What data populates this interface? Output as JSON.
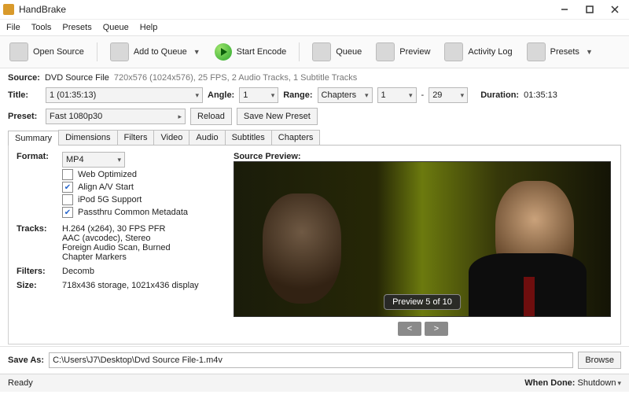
{
  "window": {
    "title": "HandBrake"
  },
  "menu": {
    "file": "File",
    "tools": "Tools",
    "presets": "Presets",
    "queue": "Queue",
    "help": "Help"
  },
  "toolbar": {
    "open_source": "Open Source",
    "add_to_queue": "Add to Queue",
    "start_encode": "Start Encode",
    "queue": "Queue",
    "preview": "Preview",
    "activity_log": "Activity Log",
    "presets": "Presets"
  },
  "source": {
    "label": "Source:",
    "name": "DVD Source File",
    "details": "720x576 (1024x576), 25 FPS, 2 Audio Tracks, 1 Subtitle Tracks"
  },
  "title": {
    "label": "Title:",
    "value": "1 (01:35:13)",
    "angle_label": "Angle:",
    "angle": "1",
    "range_label": "Range:",
    "range_mode": "Chapters",
    "range_from": "1",
    "range_sep": "-",
    "range_to": "29",
    "duration_label": "Duration:",
    "duration": "01:35:13"
  },
  "preset": {
    "label": "Preset:",
    "value": "Fast 1080p30",
    "reload": "Reload",
    "save_new": "Save New Preset"
  },
  "tabs": [
    "Summary",
    "Dimensions",
    "Filters",
    "Video",
    "Audio",
    "Subtitles",
    "Chapters"
  ],
  "summary": {
    "format_label": "Format:",
    "format": "MP4",
    "web_optimized": "Web Optimized",
    "align_av": "Align A/V Start",
    "ipod": "iPod 5G Support",
    "passthru": "Passthru Common Metadata",
    "tracks_label": "Tracks:",
    "tracks": [
      "H.264 (x264), 30 FPS PFR",
      "AAC (avcodec), Stereo",
      "Foreign Audio Scan, Burned",
      "Chapter Markers"
    ],
    "filters_label": "Filters:",
    "filters": "Decomb",
    "size_label": "Size:",
    "size": "718x436 storage, 1021x436 display"
  },
  "preview": {
    "label": "Source Preview:",
    "badge": "Preview 5 of 10",
    "prev": "<",
    "next": ">"
  },
  "save": {
    "label": "Save As:",
    "path": "C:\\Users\\J7\\Desktop\\Dvd Source File-1.m4v",
    "browse": "Browse"
  },
  "status": {
    "ready": "Ready",
    "when_done_label": "When Done:",
    "when_done": "Shutdown"
  }
}
